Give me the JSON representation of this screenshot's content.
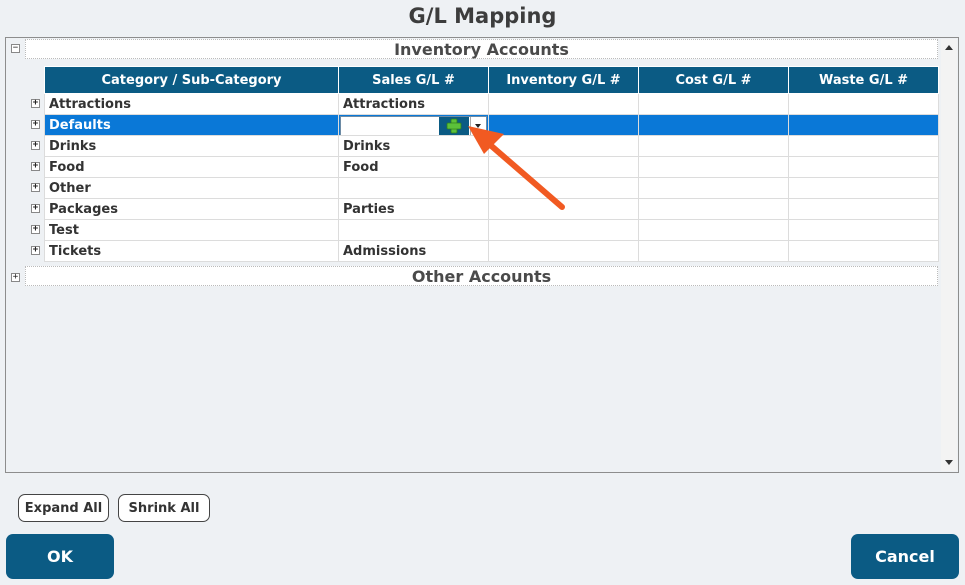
{
  "title": "G/L Mapping",
  "groups": {
    "inventory": {
      "label": "Inventory Accounts",
      "expander": "−"
    },
    "other": {
      "label": "Other Accounts",
      "expander": "+"
    }
  },
  "columns": [
    "Category / Sub-Category",
    "Sales G/L #",
    "Inventory G/L #",
    "Cost G/L #",
    "Waste G/L #"
  ],
  "rows": [
    {
      "expander": "+",
      "category": "Attractions",
      "sales": "Attractions",
      "inventory": "",
      "cost": "",
      "waste": ""
    },
    {
      "expander": "+",
      "category": "Defaults",
      "sales": "",
      "inventory": "",
      "cost": "",
      "waste": "",
      "selected": true
    },
    {
      "expander": "+",
      "category": "Drinks",
      "sales": "Drinks",
      "inventory": "",
      "cost": "",
      "waste": ""
    },
    {
      "expander": "+",
      "category": "Food",
      "sales": "Food",
      "inventory": "",
      "cost": "",
      "waste": ""
    },
    {
      "expander": "+",
      "category": "Other",
      "sales": "",
      "inventory": "",
      "cost": "",
      "waste": ""
    },
    {
      "expander": "+",
      "category": "Packages",
      "sales": "Parties",
      "inventory": "",
      "cost": "",
      "waste": ""
    },
    {
      "expander": "+",
      "category": "Test",
      "sales": "",
      "inventory": "",
      "cost": "",
      "waste": ""
    },
    {
      "expander": "+",
      "category": "Tickets",
      "sales": "Admissions",
      "inventory": "",
      "cost": "",
      "waste": ""
    }
  ],
  "editor": {
    "value": "",
    "add_icon": "plus-icon",
    "dropdown_icon": "chevron-down-icon"
  },
  "buttons": {
    "expand_all": "Expand All",
    "shrink_all": "Shrink All",
    "ok": "OK",
    "cancel": "Cancel"
  },
  "colors": {
    "header": "#0b5b84",
    "selected_row": "#0a78d7",
    "annotation_arrow": "#f15a22",
    "plus_green": "#5cc13a"
  }
}
